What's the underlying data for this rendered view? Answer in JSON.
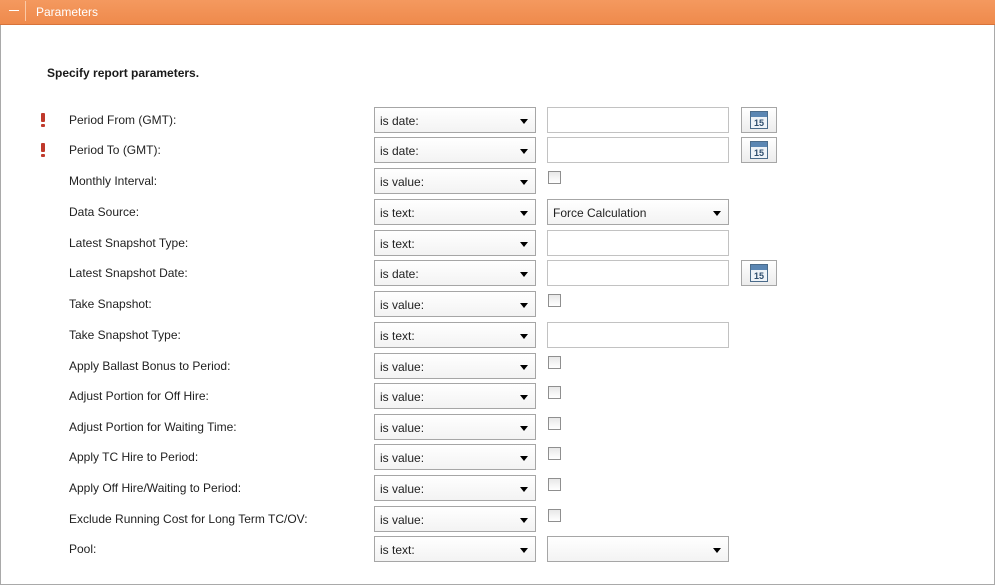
{
  "panel": {
    "title": "Parameters"
  },
  "intro": "Specify report parameters.",
  "calendar_day": "15",
  "parameters": [
    {
      "label": "Period From (GMT):",
      "required": true,
      "operator": "is date:",
      "value_type": "date",
      "value": ""
    },
    {
      "label": "Period To (GMT):",
      "required": true,
      "operator": "is date:",
      "value_type": "date",
      "value": ""
    },
    {
      "label": "Monthly Interval:",
      "required": false,
      "operator": "is value:",
      "value_type": "checkbox",
      "checked": false
    },
    {
      "label": "Data Source:",
      "required": false,
      "operator": "is text:",
      "value_type": "select",
      "value": "Force Calculation"
    },
    {
      "label": "Latest Snapshot Type:",
      "required": false,
      "operator": "is text:",
      "value_type": "text",
      "value": ""
    },
    {
      "label": "Latest Snapshot Date:",
      "required": false,
      "operator": "is date:",
      "value_type": "date",
      "value": ""
    },
    {
      "label": "Take Snapshot:",
      "required": false,
      "operator": "is value:",
      "value_type": "checkbox",
      "checked": false
    },
    {
      "label": "Take Snapshot Type:",
      "required": false,
      "operator": "is text:",
      "value_type": "text",
      "value": ""
    },
    {
      "label": "Apply Ballast Bonus to Period:",
      "required": false,
      "operator": "is value:",
      "value_type": "checkbox",
      "checked": false
    },
    {
      "label": "Adjust Portion for Off Hire:",
      "required": false,
      "operator": "is value:",
      "value_type": "checkbox",
      "checked": false
    },
    {
      "label": "Adjust Portion for Waiting Time:",
      "required": false,
      "operator": "is value:",
      "value_type": "checkbox",
      "checked": false
    },
    {
      "label": "Apply TC Hire to Period:",
      "required": false,
      "operator": "is value:",
      "value_type": "checkbox",
      "checked": false
    },
    {
      "label": "Apply Off Hire/Waiting to Period:",
      "required": false,
      "operator": "is value:",
      "value_type": "checkbox",
      "checked": false
    },
    {
      "label": "Exclude Running Cost for Long Term TC/OV:",
      "required": false,
      "operator": "is value:",
      "value_type": "checkbox",
      "checked": false
    },
    {
      "label": "Pool:",
      "required": false,
      "operator": "is text:",
      "value_type": "select",
      "value": ""
    }
  ],
  "colors": {
    "header": "#ef8a4c",
    "required_marker": "#c0392b"
  }
}
